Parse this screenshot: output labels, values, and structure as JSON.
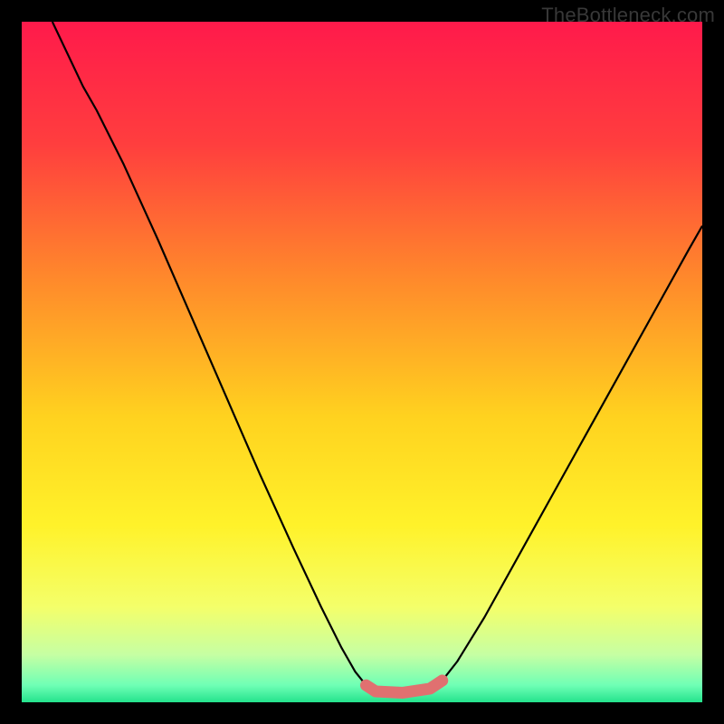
{
  "watermark": "TheBottleneck.com",
  "chart_data": {
    "type": "line",
    "title": "",
    "xlabel": "",
    "ylabel": "",
    "xlim": [
      0,
      1
    ],
    "ylim": [
      0,
      1
    ],
    "grid": false,
    "legend": false,
    "background_gradient_stops": [
      {
        "offset": 0.0,
        "color": "#ff1a4b"
      },
      {
        "offset": 0.18,
        "color": "#ff3e3e"
      },
      {
        "offset": 0.38,
        "color": "#ff8a2b"
      },
      {
        "offset": 0.58,
        "color": "#ffd21f"
      },
      {
        "offset": 0.74,
        "color": "#fff22a"
      },
      {
        "offset": 0.86,
        "color": "#f4ff6a"
      },
      {
        "offset": 0.93,
        "color": "#c6ffa3"
      },
      {
        "offset": 0.975,
        "color": "#6fffb5"
      },
      {
        "offset": 1.0,
        "color": "#24e38d"
      }
    ],
    "series": [
      {
        "name": "curve",
        "stroke": "#000000",
        "stroke_width": 2.2,
        "points": [
          {
            "x": 0.045,
            "y": 1.0
          },
          {
            "x": 0.09,
            "y": 0.905
          },
          {
            "x": 0.11,
            "y": 0.87
          },
          {
            "x": 0.15,
            "y": 0.79
          },
          {
            "x": 0.2,
            "y": 0.68
          },
          {
            "x": 0.25,
            "y": 0.565
          },
          {
            "x": 0.3,
            "y": 0.45
          },
          {
            "x": 0.35,
            "y": 0.335
          },
          {
            "x": 0.4,
            "y": 0.225
          },
          {
            "x": 0.44,
            "y": 0.14
          },
          {
            "x": 0.47,
            "y": 0.08
          },
          {
            "x": 0.49,
            "y": 0.045
          },
          {
            "x": 0.506,
            "y": 0.025
          },
          {
            "x": 0.52,
            "y": 0.016
          },
          {
            "x": 0.56,
            "y": 0.014
          },
          {
            "x": 0.6,
            "y": 0.02
          },
          {
            "x": 0.618,
            "y": 0.032
          },
          {
            "x": 0.64,
            "y": 0.06
          },
          {
            "x": 0.68,
            "y": 0.125
          },
          {
            "x": 0.73,
            "y": 0.215
          },
          {
            "x": 0.78,
            "y": 0.305
          },
          {
            "x": 0.83,
            "y": 0.395
          },
          {
            "x": 0.88,
            "y": 0.485
          },
          {
            "x": 0.93,
            "y": 0.575
          },
          {
            "x": 0.98,
            "y": 0.665
          },
          {
            "x": 1.0,
            "y": 0.7
          }
        ]
      },
      {
        "name": "highlight",
        "stroke": "#e07070",
        "stroke_width": 13,
        "linecap": "round",
        "points": [
          {
            "x": 0.506,
            "y": 0.025
          },
          {
            "x": 0.52,
            "y": 0.016
          },
          {
            "x": 0.56,
            "y": 0.014
          },
          {
            "x": 0.6,
            "y": 0.02
          },
          {
            "x": 0.618,
            "y": 0.032
          }
        ]
      }
    ]
  }
}
